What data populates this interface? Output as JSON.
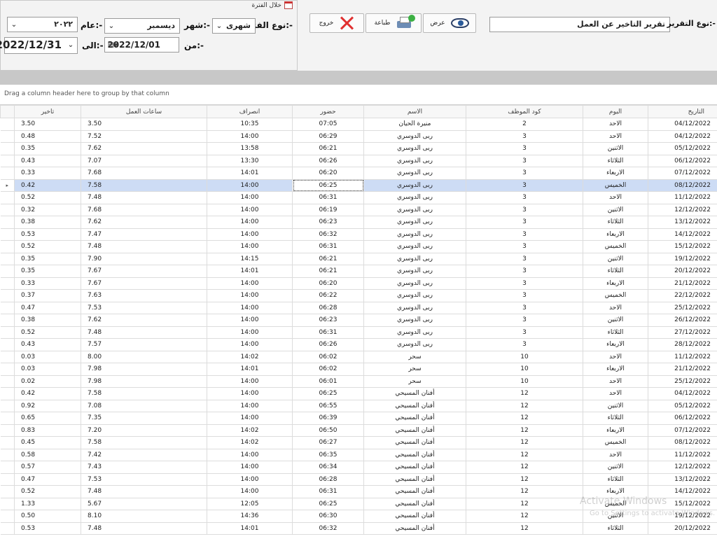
{
  "toolbar": {
    "period_group_title": "خلال الفترة",
    "report_type_label": "نوع التقرير:-",
    "report_type_value": "تقرير التاخير عن العمل",
    "view_label": "عرض",
    "print_label": "طباعة",
    "exit_label": "خروج",
    "period_type_label": "نوع الفترة:-",
    "period_type_value": "شهرى",
    "month_label": "شهر:-",
    "month_value": "ديسمبر",
    "year_label": "عام:-",
    "year_value": "٢٠٢٢",
    "from_label": "من:-",
    "from_value": "2022/12/01",
    "to_label": "الى:-",
    "to_value": "2022/12/31"
  },
  "group_panel_hint": "Drag a column header here to group by that column",
  "columns": {
    "date": "التاريخ",
    "day": "اليوم",
    "emp_code": "كود الموظف",
    "name": "الاسم",
    "check_in": "حضور",
    "check_out": "انصراف",
    "work_hours": "ساعات العمل",
    "delay": "تاخير"
  },
  "selected_row_indicator": "▸",
  "rows": [
    {
      "date": "04/12/2022",
      "day": "الاحد",
      "code": "2",
      "name": "منيرة الحيان",
      "in": "07:05",
      "out": "10:35",
      "hours": "3.50",
      "delay": "3.50"
    },
    {
      "date": "04/12/2022",
      "day": "الاحد",
      "code": "3",
      "name": "ربى الدوسري",
      "in": "06:29",
      "out": "14:00",
      "hours": "7.52",
      "delay": "0.48"
    },
    {
      "date": "05/12/2022",
      "day": "الاثنين",
      "code": "3",
      "name": "ربى الدوسري",
      "in": "06:21",
      "out": "13:58",
      "hours": "7.62",
      "delay": "0.35"
    },
    {
      "date": "06/12/2022",
      "day": "الثلاثاء",
      "code": "3",
      "name": "ربى الدوسري",
      "in": "06:26",
      "out": "13:30",
      "hours": "7.07",
      "delay": "0.43"
    },
    {
      "date": "07/12/2022",
      "day": "الاربعاء",
      "code": "3",
      "name": "ربى الدوسري",
      "in": "06:20",
      "out": "14:01",
      "hours": "7.68",
      "delay": "0.33"
    },
    {
      "date": "08/12/2022",
      "day": "الخميس",
      "code": "3",
      "name": "ربى الدوسري",
      "in": "06:25",
      "out": "14:00",
      "hours": "7.58",
      "delay": "0.42"
    },
    {
      "date": "11/12/2022",
      "day": "الاحد",
      "code": "3",
      "name": "ربى الدوسري",
      "in": "06:31",
      "out": "14:00",
      "hours": "7.48",
      "delay": "0.52"
    },
    {
      "date": "12/12/2022",
      "day": "الاثنين",
      "code": "3",
      "name": "ربى الدوسري",
      "in": "06:19",
      "out": "14:00",
      "hours": "7.68",
      "delay": "0.32"
    },
    {
      "date": "13/12/2022",
      "day": "الثلاثاء",
      "code": "3",
      "name": "ربى الدوسري",
      "in": "06:23",
      "out": "14:00",
      "hours": "7.62",
      "delay": "0.38"
    },
    {
      "date": "14/12/2022",
      "day": "الاربعاء",
      "code": "3",
      "name": "ربى الدوسري",
      "in": "06:32",
      "out": "14:00",
      "hours": "7.47",
      "delay": "0.53"
    },
    {
      "date": "15/12/2022",
      "day": "الخميس",
      "code": "3",
      "name": "ربى الدوسري",
      "in": "06:31",
      "out": "14:00",
      "hours": "7.48",
      "delay": "0.52"
    },
    {
      "date": "19/12/2022",
      "day": "الاثنين",
      "code": "3",
      "name": "ربى الدوسري",
      "in": "06:21",
      "out": "14:15",
      "hours": "7.90",
      "delay": "0.35"
    },
    {
      "date": "20/12/2022",
      "day": "الثلاثاء",
      "code": "3",
      "name": "ربى الدوسري",
      "in": "06:21",
      "out": "14:01",
      "hours": "7.67",
      "delay": "0.35"
    },
    {
      "date": "21/12/2022",
      "day": "الاربعاء",
      "code": "3",
      "name": "ربى الدوسري",
      "in": "06:20",
      "out": "14:00",
      "hours": "7.67",
      "delay": "0.33"
    },
    {
      "date": "22/12/2022",
      "day": "الخميس",
      "code": "3",
      "name": "ربى الدوسري",
      "in": "06:22",
      "out": "14:00",
      "hours": "7.63",
      "delay": "0.37"
    },
    {
      "date": "25/12/2022",
      "day": "الاحد",
      "code": "3",
      "name": "ربى الدوسري",
      "in": "06:28",
      "out": "14:00",
      "hours": "7.53",
      "delay": "0.47"
    },
    {
      "date": "26/12/2022",
      "day": "الاثنين",
      "code": "3",
      "name": "ربى الدوسري",
      "in": "06:23",
      "out": "14:00",
      "hours": "7.62",
      "delay": "0.38"
    },
    {
      "date": "27/12/2022",
      "day": "الثلاثاء",
      "code": "3",
      "name": "ربى الدوسري",
      "in": "06:31",
      "out": "14:00",
      "hours": "7.48",
      "delay": "0.52"
    },
    {
      "date": "28/12/2022",
      "day": "الاربعاء",
      "code": "3",
      "name": "ربى الدوسري",
      "in": "06:26",
      "out": "14:00",
      "hours": "7.57",
      "delay": "0.43"
    },
    {
      "date": "11/12/2022",
      "day": "الاحد",
      "code": "10",
      "name": "سحر",
      "in": "06:02",
      "out": "14:02",
      "hours": "8.00",
      "delay": "0.03"
    },
    {
      "date": "21/12/2022",
      "day": "الاربعاء",
      "code": "10",
      "name": "سحر",
      "in": "06:02",
      "out": "14:01",
      "hours": "7.98",
      "delay": "0.03"
    },
    {
      "date": "25/12/2022",
      "day": "الاحد",
      "code": "10",
      "name": "سحر",
      "in": "06:01",
      "out": "14:00",
      "hours": "7.98",
      "delay": "0.02"
    },
    {
      "date": "04/12/2022",
      "day": "الاحد",
      "code": "12",
      "name": "أفنان المسيحي",
      "in": "06:25",
      "out": "14:00",
      "hours": "7.58",
      "delay": "0.42"
    },
    {
      "date": "05/12/2022",
      "day": "الاثنين",
      "code": "12",
      "name": "أفنان المسيحي",
      "in": "06:55",
      "out": "14:00",
      "hours": "7.08",
      "delay": "0.92"
    },
    {
      "date": "06/12/2022",
      "day": "الثلاثاء",
      "code": "12",
      "name": "أفنان المسيحي",
      "in": "06:39",
      "out": "14:00",
      "hours": "7.35",
      "delay": "0.65"
    },
    {
      "date": "07/12/2022",
      "day": "الاربعاء",
      "code": "12",
      "name": "أفنان المسيحي",
      "in": "06:50",
      "out": "14:02",
      "hours": "7.20",
      "delay": "0.83"
    },
    {
      "date": "08/12/2022",
      "day": "الخميس",
      "code": "12",
      "name": "أفنان المسيحي",
      "in": "06:27",
      "out": "14:02",
      "hours": "7.58",
      "delay": "0.45"
    },
    {
      "date": "11/12/2022",
      "day": "الاحد",
      "code": "12",
      "name": "أفنان المسيحي",
      "in": "06:35",
      "out": "14:00",
      "hours": "7.42",
      "delay": "0.58"
    },
    {
      "date": "12/12/2022",
      "day": "الاثنين",
      "code": "12",
      "name": "أفنان المسيحي",
      "in": "06:34",
      "out": "14:00",
      "hours": "7.43",
      "delay": "0.57"
    },
    {
      "date": "13/12/2022",
      "day": "الثلاثاء",
      "code": "12",
      "name": "أفنان المسيحي",
      "in": "06:28",
      "out": "14:00",
      "hours": "7.53",
      "delay": "0.47"
    },
    {
      "date": "14/12/2022",
      "day": "الاربعاء",
      "code": "12",
      "name": "أفنان المسيحي",
      "in": "06:31",
      "out": "14:00",
      "hours": "7.48",
      "delay": "0.52"
    },
    {
      "date": "15/12/2022",
      "day": "الخميس",
      "code": "12",
      "name": "أفنان المسيحي",
      "in": "06:25",
      "out": "12:05",
      "hours": "5.67",
      "delay": "1.33"
    },
    {
      "date": "19/12/2022",
      "day": "الاثنين",
      "code": "12",
      "name": "أفنان المسيحي",
      "in": "06:30",
      "out": "14:36",
      "hours": "8.10",
      "delay": "0.50"
    },
    {
      "date": "20/12/2022",
      "day": "الثلاثاء",
      "code": "12",
      "name": "أفنان المسيحي",
      "in": "06:32",
      "out": "14:01",
      "hours": "7.48",
      "delay": "0.53"
    }
  ],
  "selected_row_index": 5,
  "watermark_line1": "Activate Windows",
  "watermark_line2": "Go to Settings to activate Windows."
}
